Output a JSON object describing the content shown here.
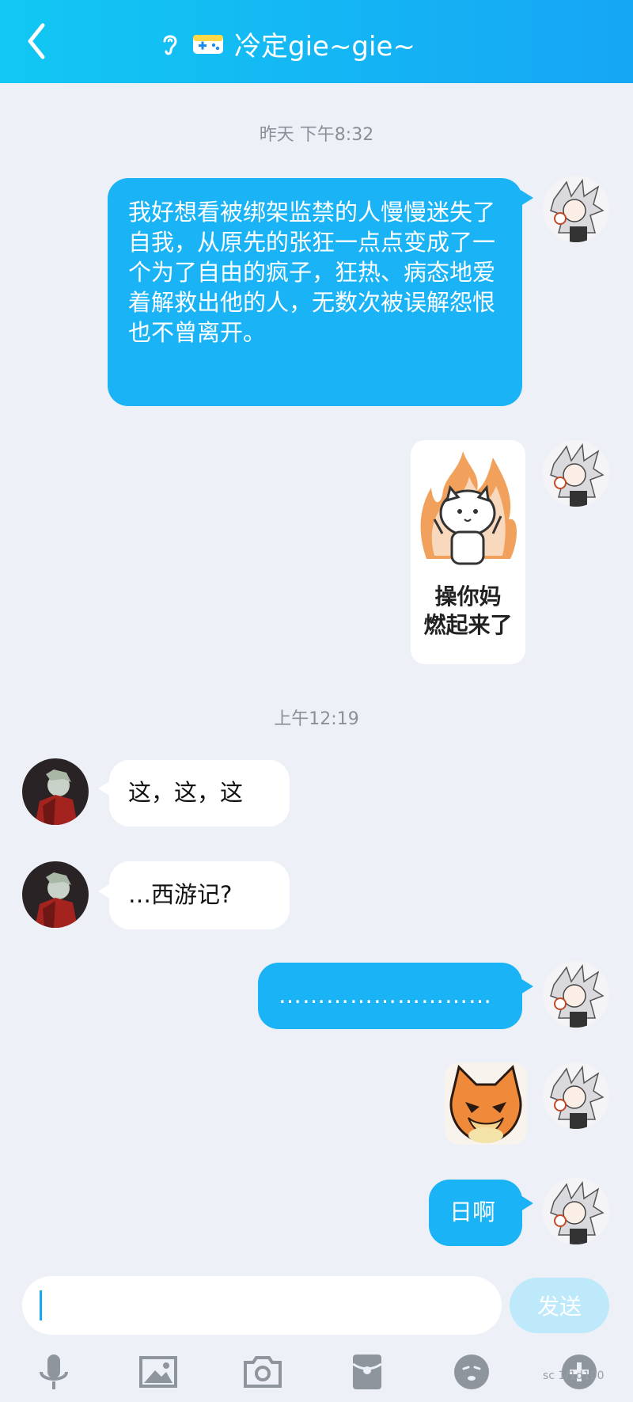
{
  "header": {
    "title": "冷定gie~gie~"
  },
  "timestamps": {
    "first": "昨天 下午8:32",
    "second": "上午12:19"
  },
  "messages": {
    "m1": "我好想看被绑架监禁的人慢慢迷失了自我，从原先的张狂一点点变成了一个为了自由的疯子，狂热、病态地爱着解救出他的人，无数次被误解怨恨也不曾离开。",
    "sticker1": {
      "line1": "操你妈",
      "line2": "燃起来了"
    },
    "m3": "这，这，这",
    "m4": "…西游记?",
    "m5": "………………………",
    "m7": "日啊"
  },
  "input": {
    "send_label": "发送",
    "placeholder": ""
  },
  "watermark": "sc 1/1d100",
  "colors": {
    "accent": "#1ab3f5",
    "header": "#16b3f4",
    "background": "#eef0f7"
  }
}
